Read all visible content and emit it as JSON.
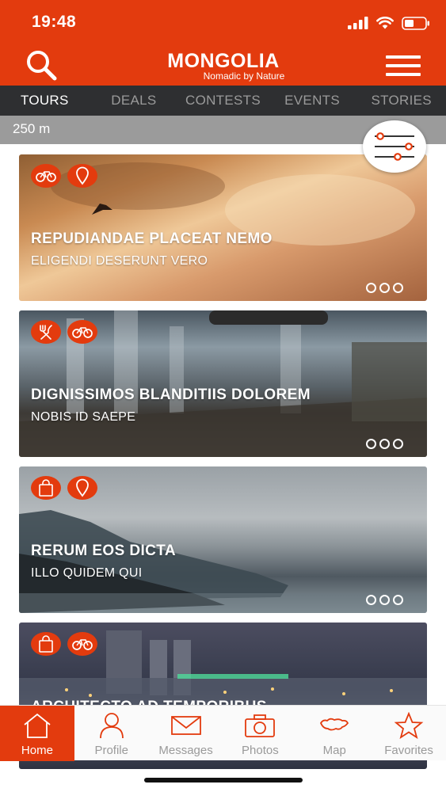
{
  "status_bar": {
    "time": "19:48",
    "icons": [
      "signal-icon",
      "wifi-icon",
      "battery-icon"
    ]
  },
  "header": {
    "logo_title": "MONGOLIA",
    "logo_tagline": "Nomadic by Nature",
    "icons": [
      "search-icon",
      "hamburger-menu-icon"
    ]
  },
  "tabs": [
    {
      "label": "TOURS",
      "active": true
    },
    {
      "label": "DEALS",
      "active": false
    },
    {
      "label": "CONTESTS",
      "active": false
    },
    {
      "label": "EVENTS",
      "active": false
    },
    {
      "label": "STORIES",
      "active": false
    }
  ],
  "distance": {
    "label": "250 m"
  },
  "filter_button": {
    "icon": "filter-sliders-icon"
  },
  "cards": [
    {
      "title": "REPUDIANDAE PLACEAT NEMO",
      "subtitle": "ELIGENDI DESERUNT VERO",
      "badges": [
        "bicycle-icon",
        "map-pin-icon"
      ]
    },
    {
      "title": "DIGNISSIMOS BLANDITIIS DOLOREM",
      "subtitle": "NOBIS ID SAEPE",
      "badges": [
        "fork-knife-icon",
        "bicycle-icon"
      ]
    },
    {
      "title": "RERUM EOS DICTA",
      "subtitle": "ILLO QUIDEM QUI",
      "badges": [
        "shopping-bag-icon",
        "map-pin-icon"
      ]
    },
    {
      "title": "ARCHITECTO AD TEMPORIBUS",
      "subtitle": "",
      "badges": [
        "shopping-bag-icon",
        "bicycle-icon"
      ]
    }
  ],
  "bottom_nav": [
    {
      "label": "Home",
      "icon": "home-icon",
      "active": true
    },
    {
      "label": "Profile",
      "icon": "profile-icon",
      "active": false
    },
    {
      "label": "Messages",
      "icon": "envelope-icon",
      "active": false
    },
    {
      "label": "Photos",
      "icon": "camera-icon",
      "active": false
    },
    {
      "label": "Map",
      "icon": "mongolia-map-icon",
      "active": false
    },
    {
      "label": "Favorites",
      "icon": "star-icon",
      "active": false
    }
  ],
  "colors": {
    "accent": "#e33b0e",
    "tab_bar": "#2e2f31",
    "distance_bar": "#9b9b9b",
    "inactive_text": "#9a9a9a"
  }
}
